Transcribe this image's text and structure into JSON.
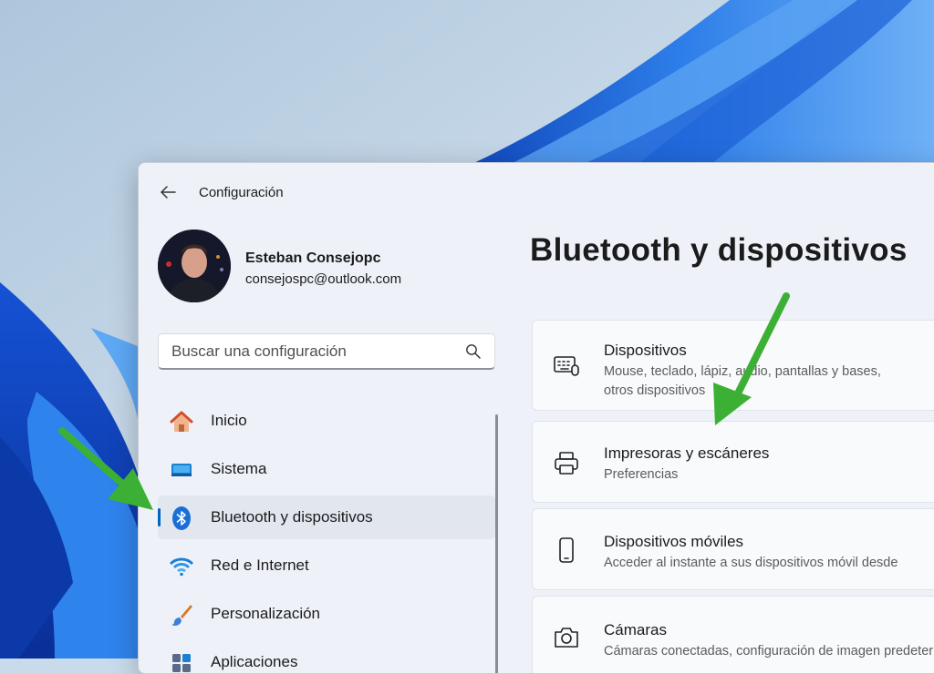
{
  "app": {
    "title": "Configuración"
  },
  "user": {
    "name": "Esteban Consejopc",
    "email": "consejospc@outlook.com"
  },
  "search": {
    "placeholder": "Buscar una configuración"
  },
  "nav": {
    "items": [
      {
        "label": "Inicio",
        "icon": "home-icon"
      },
      {
        "label": "Sistema",
        "icon": "system-icon"
      },
      {
        "label": "Bluetooth y dispositivos",
        "icon": "bluetooth-icon",
        "selected": true
      },
      {
        "label": "Red e Internet",
        "icon": "wifi-icon"
      },
      {
        "label": "Personalización",
        "icon": "brush-icon"
      },
      {
        "label": "Aplicaciones",
        "icon": "apps-icon"
      }
    ]
  },
  "main": {
    "title": "Bluetooth y dispositivos",
    "cards": [
      {
        "title": "Dispositivos",
        "desc1": "Mouse, teclado, lápiz, audio, pantallas y bases,",
        "desc2": "otros dispositivos",
        "icon": "devices-icon"
      },
      {
        "title": "Impresoras y escáneres",
        "desc1": "Preferencias",
        "icon": "printer-icon"
      },
      {
        "title": "Dispositivos móviles",
        "desc1": "Acceder al instante a sus dispositivos móvil desde",
        "icon": "phone-icon"
      },
      {
        "title": "Cámaras",
        "desc1": "Cámaras conectadas, configuración de imagen predeterminada",
        "icon": "camera-icon"
      }
    ]
  },
  "colors": {
    "accent": "#0067c0",
    "annotation_arrow": "#3cb034",
    "window_bg": "#eef2f8",
    "card_bg": "#f9fafc"
  }
}
